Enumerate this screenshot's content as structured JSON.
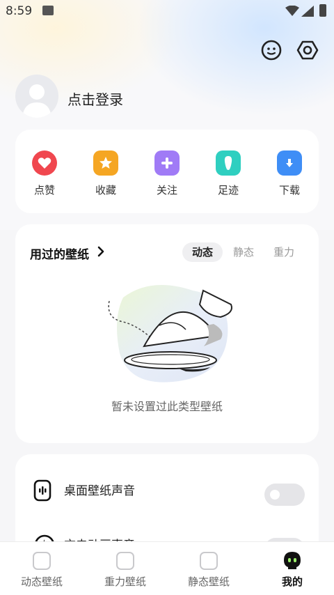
{
  "status_bar": {
    "time": "8:59"
  },
  "profile": {
    "login_label": "点击登录"
  },
  "quick_actions": [
    {
      "label": "点赞",
      "icon": "heart-icon",
      "color": "#f0474f"
    },
    {
      "label": "收藏",
      "icon": "star-icon",
      "color": "#f5a623"
    },
    {
      "label": "关注",
      "icon": "plus-icon",
      "color": "#a07bf6"
    },
    {
      "label": "足迹",
      "icon": "footprint-icon",
      "color": "#2fcfc0"
    },
    {
      "label": "下载",
      "icon": "download-folder-icon",
      "color": "#3f8ef6"
    }
  ],
  "used_wallpapers": {
    "title": "用过的壁纸",
    "tabs": [
      "动态",
      "静态",
      "重力"
    ],
    "active_tab": "动态",
    "empty_text": "暂未设置过此类型壁纸"
  },
  "settings": [
    {
      "label": "桌面壁纸声音",
      "icon": "sound-wave-icon",
      "enabled": false
    },
    {
      "label": "充电动画声音",
      "icon": "charging-sound-icon",
      "enabled": false
    }
  ],
  "bottom_nav": [
    {
      "label": "动态壁纸",
      "icon": "play-icon"
    },
    {
      "label": "重力壁纸",
      "icon": "gravity-icon"
    },
    {
      "label": "静态壁纸",
      "icon": "image-icon"
    },
    {
      "label": "我的",
      "icon": "alien-face-icon",
      "active": true
    }
  ],
  "colors": {
    "accent": "#111111",
    "background": "#f6f6f8"
  }
}
